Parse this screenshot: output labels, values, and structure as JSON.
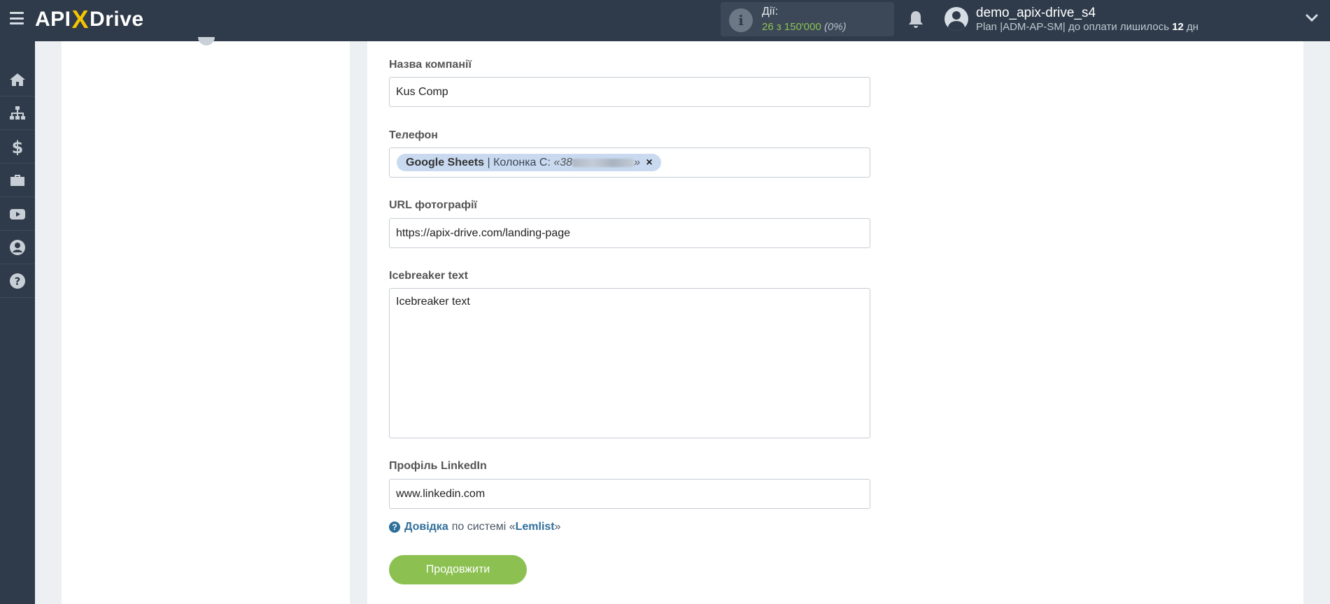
{
  "header": {
    "logo_left": "API",
    "logo_x": "X",
    "logo_right": "Drive",
    "actions": {
      "label": "Дії:",
      "count": "26 з 150'000",
      "percent": "(0%)"
    },
    "user": {
      "name": "demo_apix-drive_s4",
      "plan_prefix": "Plan |ADM-AP-SM| до оплати лишилось",
      "days": "12",
      "days_suffix": "дн"
    }
  },
  "sidebar": {
    "items": [
      {
        "icon": "home-icon"
      },
      {
        "icon": "sitemap-icon"
      },
      {
        "icon": "dollar-icon"
      },
      {
        "icon": "briefcase-icon"
      },
      {
        "icon": "youtube-icon"
      },
      {
        "icon": "user-circle-icon"
      },
      {
        "icon": "question-circle-icon"
      }
    ]
  },
  "form": {
    "company": {
      "label": "Назва компанії",
      "value": "Kus Comp"
    },
    "phone": {
      "label": "Телефон",
      "tag_source": "Google Sheets",
      "tag_column": "| Колонка С:",
      "tag_value_prefix": "«38",
      "tag_value_suffix": "»",
      "tag_close": "×"
    },
    "photo_url": {
      "label": "URL фотографії",
      "value": "https://apix-drive.com/landing-page"
    },
    "icebreaker": {
      "label": "Icebreaker text",
      "value": "Icebreaker text"
    },
    "linkedin": {
      "label": "Профіль LinkedIn",
      "value": "www.linkedin.com"
    },
    "help": {
      "link": "Довідка",
      "text": "по системі «",
      "system": "Lemlist",
      "close_quote": "»"
    },
    "continue_label": "Продовжити"
  }
}
